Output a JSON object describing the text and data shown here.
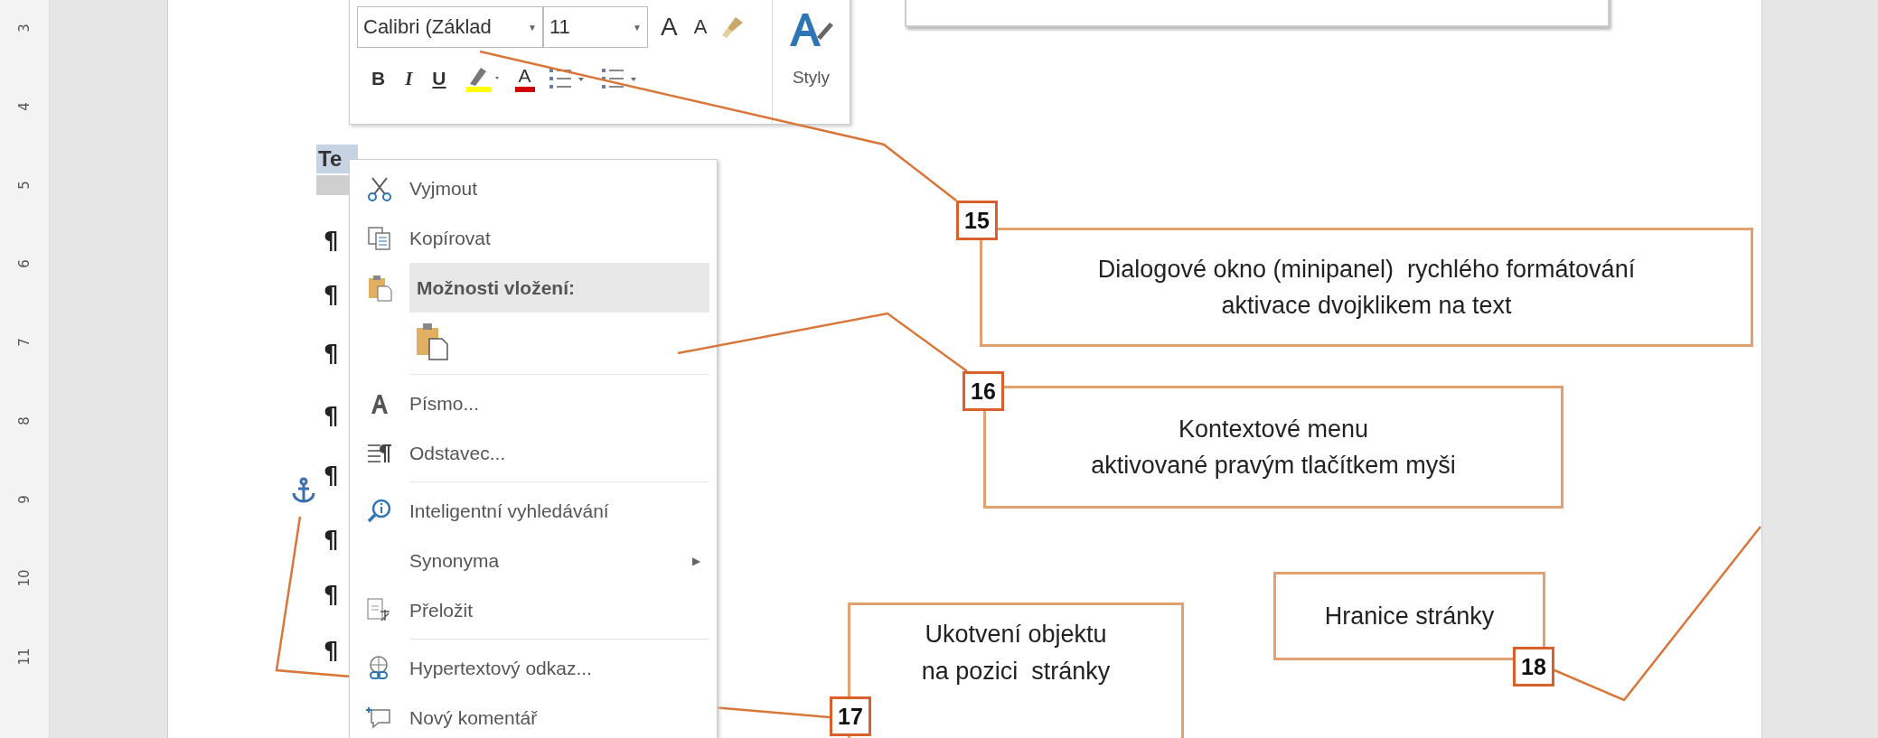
{
  "ruler": {
    "marks": [
      "3",
      "4",
      "5",
      "6",
      "7",
      "8",
      "9",
      "10",
      "11"
    ]
  },
  "mini_toolbar": {
    "font": "Calibri (Základ",
    "size": "11",
    "dropdown_caret": "▼",
    "grow_label": "A",
    "shrink_label": "A",
    "format_buttons": [
      {
        "kind": "bold",
        "label": "B"
      },
      {
        "kind": "italic",
        "label": "I"
      },
      {
        "kind": "underline",
        "label": "U"
      },
      {
        "kind": "highlight"
      },
      {
        "kind": "font_color",
        "label": "A"
      },
      {
        "kind": "bullets"
      },
      {
        "kind": "numbering"
      }
    ],
    "styles_label": "Styly"
  },
  "document": {
    "selected_text": "Te",
    "paragraph_marks": [
      "¶",
      "¶",
      "¶",
      "¶",
      "¶",
      "¶",
      "¶",
      "¶"
    ]
  },
  "context_menu": {
    "items": [
      {
        "kind": "command",
        "label": "Vyjmout",
        "selected": false
      },
      {
        "kind": "command",
        "label": "Kopírovat",
        "selected": false
      },
      {
        "kind": "header",
        "label": "Možnosti vložení:",
        "selected": true
      },
      {
        "kind": "paste_option",
        "selected": false
      },
      {
        "kind": "separator"
      },
      {
        "kind": "command",
        "label": "Písmo...",
        "selected": false
      },
      {
        "kind": "command",
        "label": "Odstavec...",
        "selected": false
      },
      {
        "kind": "separator"
      },
      {
        "kind": "command",
        "label": "Inteligentní vyhledávání",
        "selected": false
      },
      {
        "kind": "submenu",
        "label": "Synonyma",
        "arrow": "▶",
        "selected": false
      },
      {
        "kind": "command",
        "label": "Přeložit",
        "selected": false
      },
      {
        "kind": "separator"
      },
      {
        "kind": "command",
        "label": "Hypertextový odkaz...",
        "selected": false
      },
      {
        "kind": "command",
        "label": "Nový komentář",
        "selected": false
      }
    ]
  },
  "callouts": [
    {
      "number": "15",
      "lines": [
        "Dialogové okno (minipanel)  rychlého formátování",
        "aktivace dvojklikem na text"
      ]
    },
    {
      "number": "16",
      "lines": [
        "Kontextové menu",
        "aktivované pravým tlačítkem myši"
      ]
    },
    {
      "number": "17",
      "lines": [
        "Ukotvení objektu",
        "na pozici  stránky"
      ]
    },
    {
      "number": "18",
      "lines": [
        "Hranice stránky"
      ]
    }
  ]
}
